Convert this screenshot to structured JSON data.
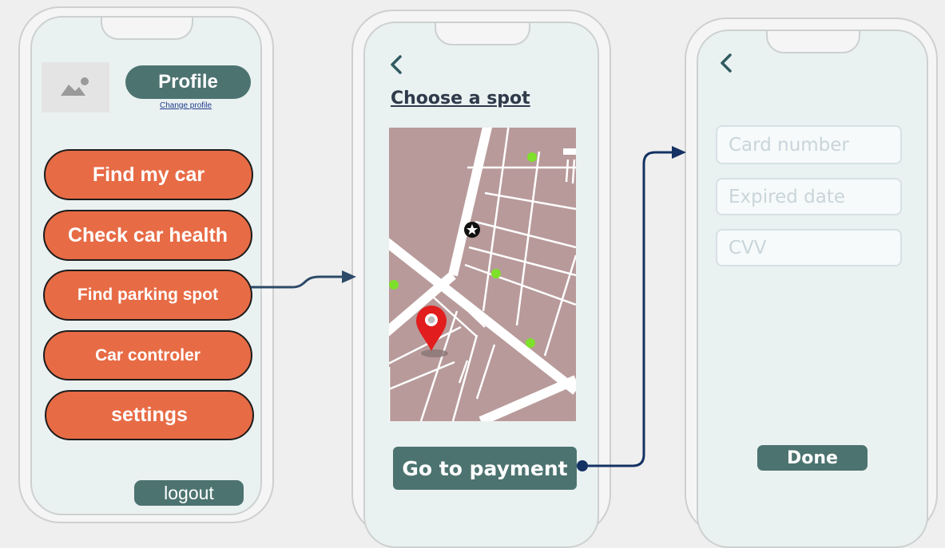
{
  "screen1": {
    "avatar_icon": "image-placeholder-icon",
    "profile_label": "Profile",
    "change_profile_link": "Change profile",
    "menu": [
      {
        "label": "Find my car"
      },
      {
        "label": "Check car health"
      },
      {
        "label": "Find parking spot"
      },
      {
        "label": "Car controler"
      },
      {
        "label": "settings"
      }
    ],
    "logout_label": "logout"
  },
  "screen2": {
    "back_icon": "chevron-left-icon",
    "title": "Choose a spot",
    "map": {
      "selected_pin_icon": "location-pin-icon",
      "landmark_icon": "star-marker-icon",
      "available_spot_count": 4,
      "available_spot_color": "#7ee02a"
    },
    "payment_button": "Go to payment"
  },
  "screen3": {
    "back_icon": "chevron-left-icon",
    "card_number_placeholder": "Card number",
    "expired_date_placeholder": "Expired date",
    "cvv_placeholder": "CVV",
    "done_button": "Done"
  },
  "colors": {
    "accent_orange": "#e76b45",
    "teal": "#4c7370",
    "flow_arrow": "#143263",
    "map_block": "#b89a9a"
  }
}
